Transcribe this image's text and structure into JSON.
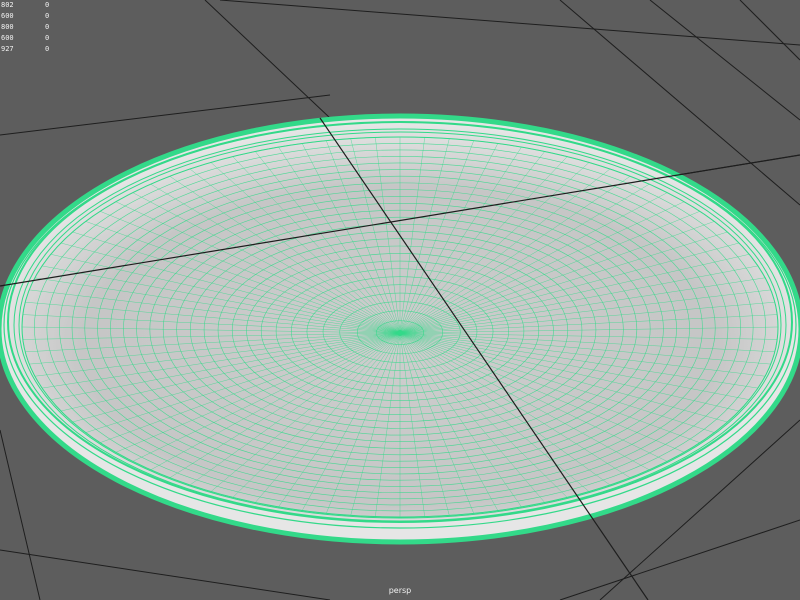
{
  "viewport": {
    "camera_label": "persp",
    "background_color": "#5d5d5d",
    "grid_color": "#1e1e1e",
    "wireframe_color": "#33d989"
  },
  "hud": {
    "rows": [
      {
        "value": "802",
        "zero": "0"
      },
      {
        "value": "600",
        "zero": "0"
      },
      {
        "value": "800",
        "zero": "0"
      },
      {
        "value": "600",
        "zero": "0"
      },
      {
        "value": "927",
        "zero": "0"
      }
    ]
  },
  "object": {
    "icon": "plate-mesh-icon"
  }
}
